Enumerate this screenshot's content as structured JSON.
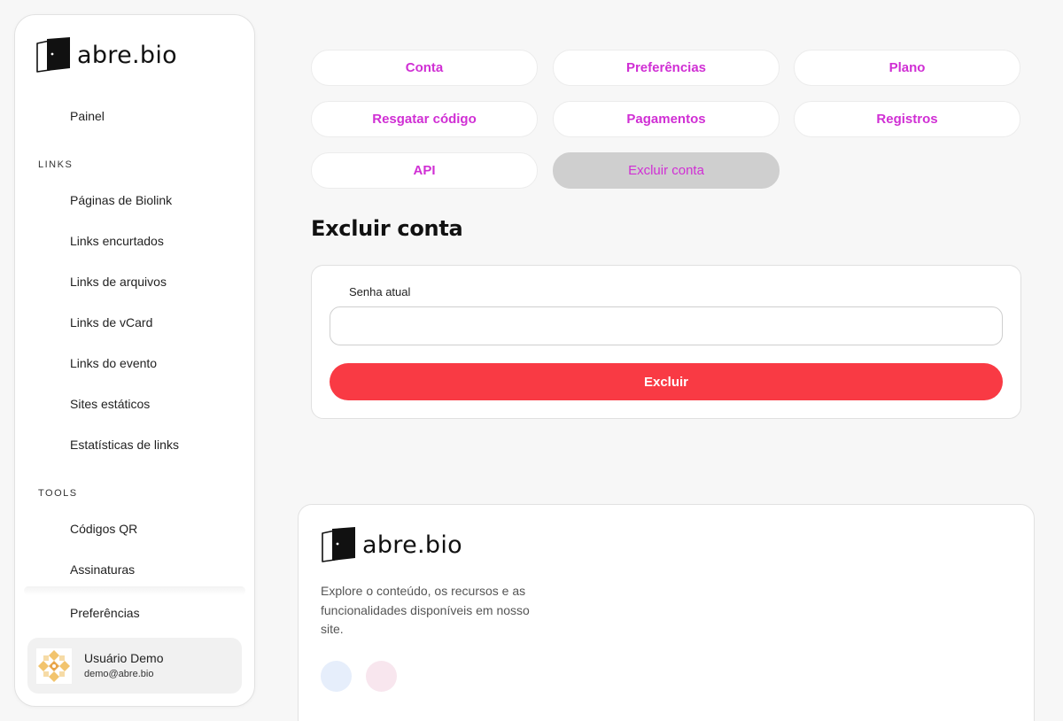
{
  "brand": {
    "name": "abre.bio"
  },
  "sidebar": {
    "dashboard": "Painel",
    "sections": {
      "links": "LINKS",
      "tools": "TOOLS"
    },
    "links_items": [
      "Páginas de Biolink",
      "Links encurtados",
      "Links de arquivos",
      "Links de vCard",
      "Links do evento",
      "Sites estáticos",
      "Estatísticas de links"
    ],
    "tools_items": [
      "Códigos QR",
      "Assinaturas"
    ],
    "preferences": "Preferências",
    "user": {
      "name": "Usuário Demo",
      "email": "demo@abre.bio"
    }
  },
  "tabs": [
    {
      "label": "Conta",
      "active": false
    },
    {
      "label": "Preferências",
      "active": false
    },
    {
      "label": "Plano",
      "active": false
    },
    {
      "label": "Resgatar código",
      "active": false
    },
    {
      "label": "Pagamentos",
      "active": false
    },
    {
      "label": "Registros",
      "active": false
    },
    {
      "label": "API",
      "active": false
    },
    {
      "label": "Excluir conta",
      "active": true
    }
  ],
  "main": {
    "title": "Excluir conta",
    "form": {
      "password_label": "Senha atual",
      "password_value": "",
      "submit_label": "Excluir"
    }
  },
  "footer": {
    "description": "Explore o conteúdo, os recursos e as funcionalidades disponíveis em nosso site."
  },
  "colors": {
    "accent": "#d02fd4",
    "danger": "#f93a44",
    "active_tab": "#cfcfcf",
    "social_1": "#e6eefb",
    "social_2": "#f8e6ee"
  }
}
